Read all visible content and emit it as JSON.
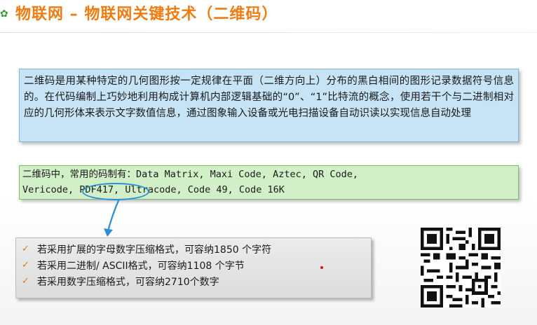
{
  "title": "物联网 – 物联网关键技术（二维码）",
  "definition": "二维码是用某种特定的几何图形按一定规律在平面（二维方向上）分布的黑白相间的图形记录数据符号信息的。在代码编制上巧妙地利用构成计算机内部逻辑基础的“0”、“1”比特流的概念，使用若干个与二进制相对应的几何形体来表示文字数值信息，通过图象输入设备或光电扫描设备自动识读以实现信息自动处理",
  "codes": {
    "line1_prefix": "二维码中，常用的码制有：",
    "line1_codes": "Data Matrix,  Maxi Code,  Aztec,  QR Code,",
    "line2_a": "Vericode, ",
    "line2_highlight": "PDF417,",
    "line2_b": " Ultracode,  Code 49,  Code 16K"
  },
  "capacity": [
    {
      "text": "若采用扩展的字母数字压缩格式，可容纳1850 个字符"
    },
    {
      "text": "若采用二进制/ ASCII格式，可容纳1108 个字节"
    },
    {
      "text": "若采用数字压缩格式，可容纳2710个数字"
    }
  ],
  "icons": {
    "title_bullet": "clover-bullet-icon",
    "check": "checkmark-icon",
    "arrow": "down-arrow-icon",
    "qr": "qr-code-image"
  },
  "colors": {
    "title": "#f07b10",
    "definition_bg": "#c6e4f6",
    "codes_bg": "#d2f0c8",
    "capacity_bg": "#e2e2e2",
    "highlight_circle": "#2a8fd6",
    "check": "#e07a10"
  }
}
